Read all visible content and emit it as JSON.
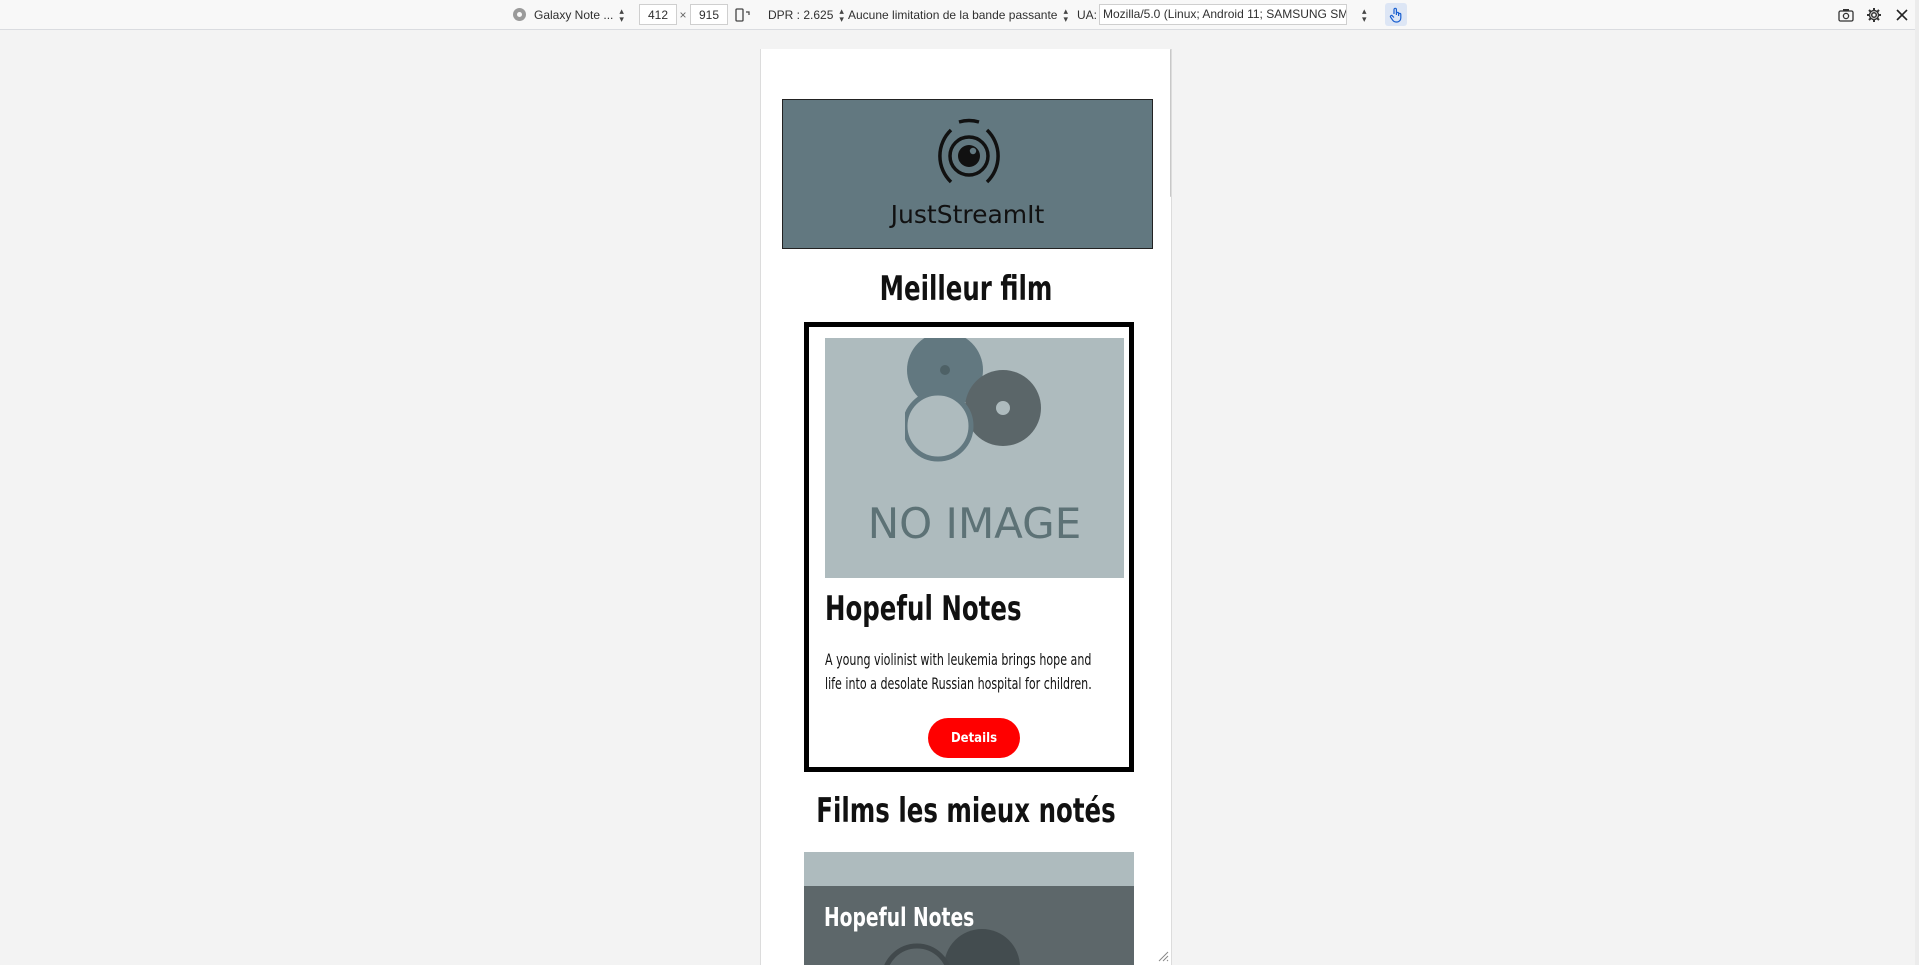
{
  "devtools": {
    "device_name": "Galaxy Note ...",
    "width": "412",
    "times": "×",
    "height": "915",
    "dpr": "DPR : 2.625",
    "throttling": "Aucune limitation de la bande passante",
    "ua_label": "UA:",
    "ua_value": "Mozilla/5.0 (Linux; Android 11; SAMSUNG SM-"
  },
  "site": {
    "logo_text": "JustStreamIt"
  },
  "best_movie": {
    "section_title": "Meilleur film",
    "image_placeholder": "NO IMAGE",
    "title": "Hopeful Notes",
    "description": "A young violinist with leukemia brings hope and life into a desolate Russian hospital for children.",
    "button_label": "Details"
  },
  "top_rated": {
    "section_title": "Films les mieux notés",
    "first_title": "Hopeful Notes"
  },
  "colors": {
    "logo_bg": "#627880",
    "accent_button": "#ff0000",
    "placeholder_bg": "#aebbbe"
  }
}
